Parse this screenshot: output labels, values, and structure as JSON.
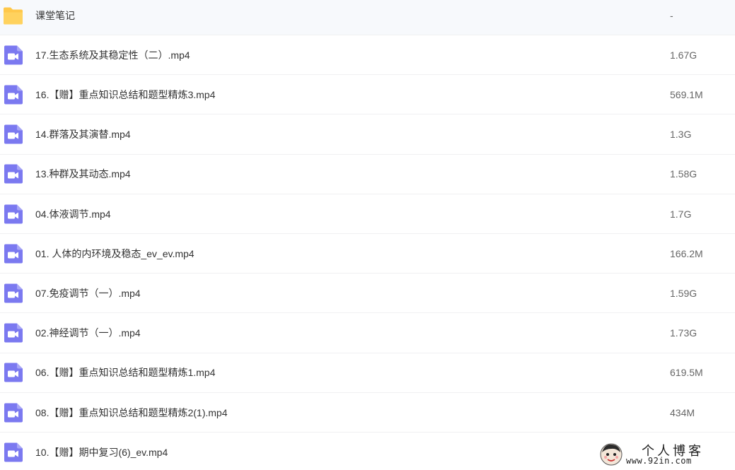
{
  "rows": [
    {
      "name": "课堂笔记",
      "size": "-",
      "icon": "folder-icon"
    },
    {
      "name": "17.生态系统及其稳定性（二）.mp4",
      "size": "1.67G",
      "icon": "video-file-icon"
    },
    {
      "name": "16.【赠】重点知识总结和题型精炼3.mp4",
      "size": "569.1M",
      "icon": "video-file-icon"
    },
    {
      "name": "14.群落及其演替.mp4",
      "size": "1.3G",
      "icon": "video-file-icon"
    },
    {
      "name": "13.种群及其动态.mp4",
      "size": "1.58G",
      "icon": "video-file-icon"
    },
    {
      "name": "04.体液调节.mp4",
      "size": "1.7G",
      "icon": "video-file-icon"
    },
    {
      "name": "01. 人体的内环境及稳态_ev_ev.mp4",
      "size": "166.2M",
      "icon": "video-file-icon"
    },
    {
      "name": "07.免疫调节（一）.mp4",
      "size": "1.59G",
      "icon": "video-file-icon"
    },
    {
      "name": "02.神经调节（一）.mp4",
      "size": "1.73G",
      "icon": "video-file-icon"
    },
    {
      "name": "06.【赠】重点知识总结和题型精炼1.mp4",
      "size": "619.5M",
      "icon": "video-file-icon"
    },
    {
      "name": "08.【赠】重点知识总结和题型精炼2(1).mp4",
      "size": "434M",
      "icon": "video-file-icon"
    },
    {
      "name": "10.【赠】期中复习(6)_ev.mp4",
      "size": "",
      "icon": "video-file-icon"
    }
  ],
  "watermark": {
    "title": "个人博客",
    "url": "www.92in.com"
  },
  "colors": {
    "folder": "#ffc84a",
    "video": "#7b79f0",
    "text": "#333333",
    "divider": "#f0f0f2"
  }
}
